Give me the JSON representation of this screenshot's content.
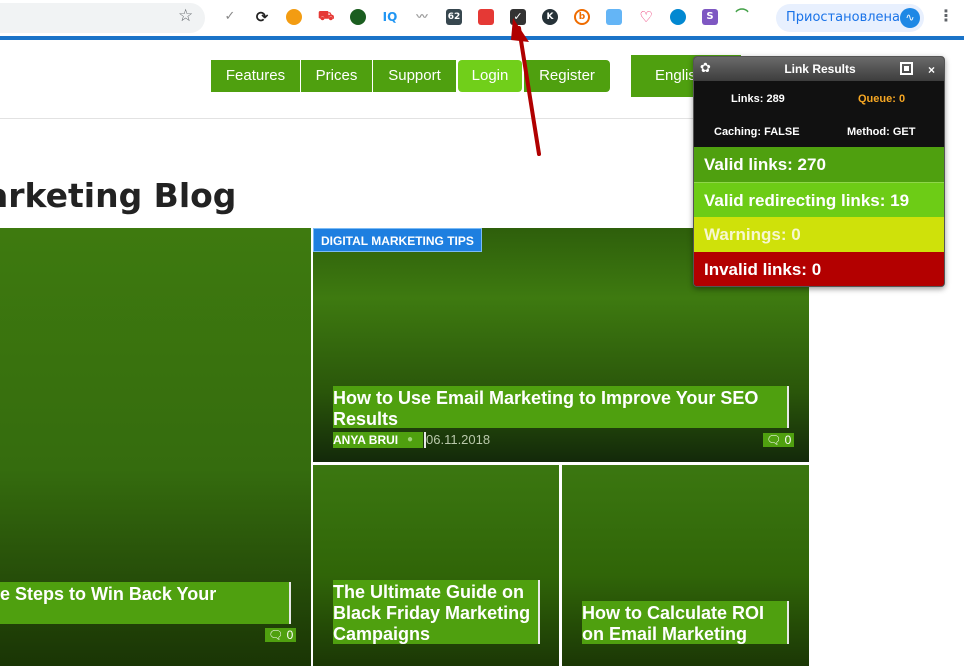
{
  "browser": {
    "profile_label": "Приостановлена",
    "extension_badges": {
      "iq": "IQ",
      "num": "62",
      "k": "K",
      "s": "S"
    }
  },
  "nav": {
    "features": "Features",
    "prices": "Prices",
    "support": "Support",
    "login": "Login",
    "register": "Register",
    "language": "Englis"
  },
  "page": {
    "title": "arketing Blog"
  },
  "posts": [
    {
      "title": "e Steps to Win Back Your",
      "comments": "0"
    },
    {
      "category": "DIGITAL MARKETING TIPS",
      "title": "How to Use Email Marketing to Improve Your SEO Results",
      "author": "ANYA BRUI",
      "date": "06.11.2018",
      "comments": "0"
    },
    {
      "title": "The Ultimate Guide on Black Friday Marketing Campaigns"
    },
    {
      "title": "How to Calculate ROI on Email Marketing"
    }
  ],
  "link_results": {
    "title": "Link Results",
    "links": "Links: 289",
    "queue": "Queue: 0",
    "caching": "Caching: FALSE",
    "method": "Method: GET",
    "valid": "Valid links: 270",
    "valid_redirecting": "Valid redirecting links: 19",
    "warnings": "Warnings: 0",
    "invalid": "Invalid links: 0",
    "close": "×"
  },
  "colors": {
    "accent_green": "#4fa00f",
    "login_green": "#71cf1a",
    "tag_blue": "#1e7fe0",
    "warning_yellow": "#cfe10a",
    "invalid_red": "#b30000"
  }
}
